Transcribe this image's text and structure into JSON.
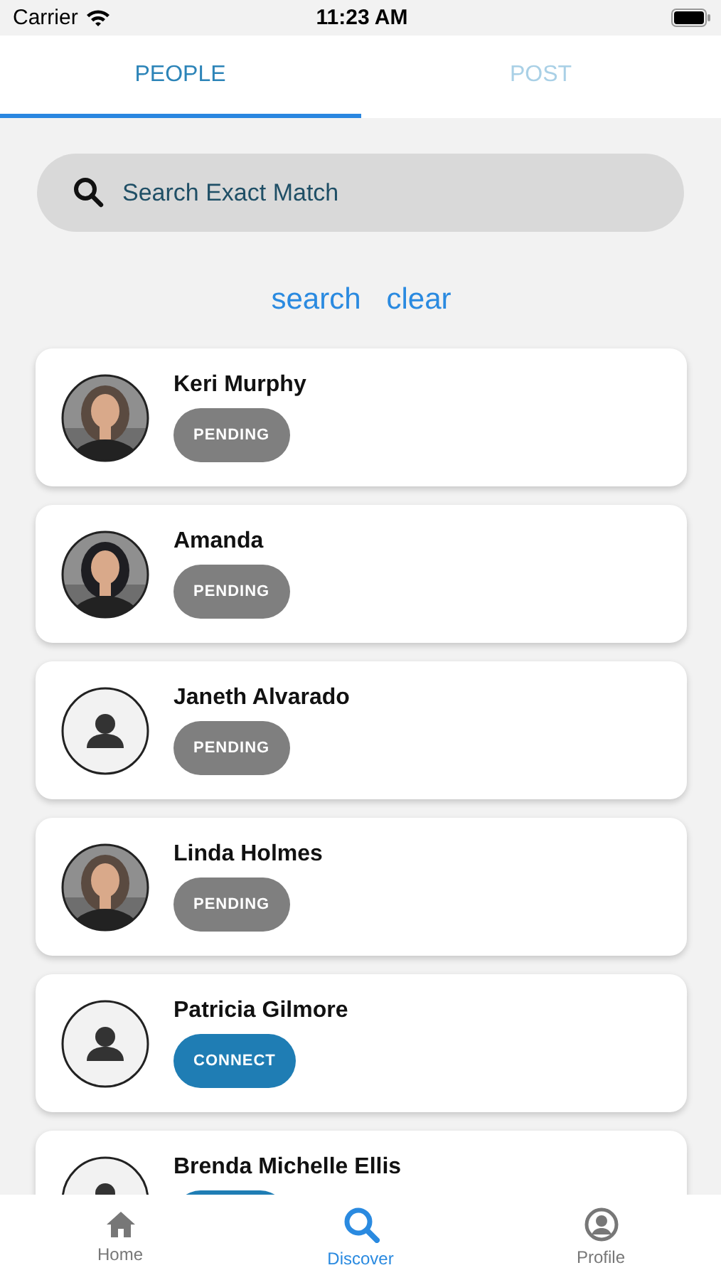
{
  "status_bar": {
    "carrier": "Carrier",
    "time": "11:23 AM"
  },
  "tabs": [
    {
      "label": "PEOPLE",
      "selected": true
    },
    {
      "label": "POST",
      "selected": false
    }
  ],
  "search": {
    "placeholder": "Search Exact Match"
  },
  "actions": [
    "search",
    "clear"
  ],
  "people": [
    {
      "name": "Keri Murphy",
      "kind": "picture",
      "status": {
        "kind": "pending",
        "label": "PENDING"
      }
    },
    {
      "name": "Amanda",
      "kind": "picture",
      "status": {
        "kind": "pending",
        "label": "PENDING"
      }
    },
    {
      "name": "Janeth Alvarado",
      "kind": "placeholder",
      "status": {
        "kind": "pending",
        "label": "PENDING"
      }
    },
    {
      "name": "Linda Holmes",
      "kind": "picture",
      "status": {
        "kind": "pending",
        "label": "PENDING"
      }
    },
    {
      "name": "Patricia Gilmore",
      "kind": "placeholder",
      "status": {
        "kind": "connect",
        "label": "CONNECT"
      }
    },
    {
      "name": "Brenda Michelle Ellis",
      "kind": "placeholder",
      "status": {
        "kind": "connect"
      }
    }
  ],
  "bottom_nav": [
    {
      "label": "Home",
      "selected": false
    },
    {
      "label": "Discover",
      "selected": true
    },
    {
      "label": "Profile",
      "selected": false
    }
  ]
}
